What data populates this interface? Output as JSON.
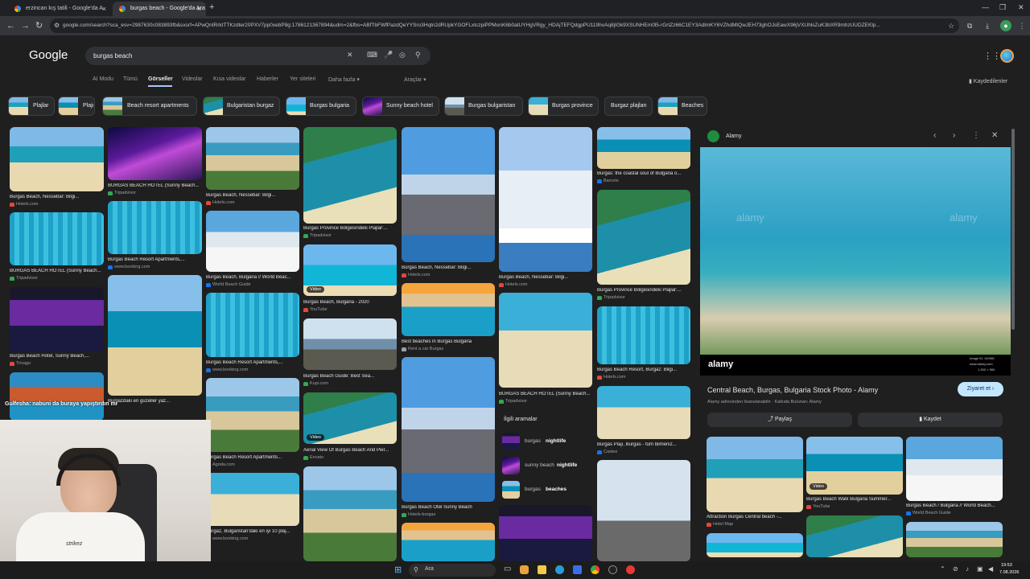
{
  "browser": {
    "tabs": [
      {
        "title": "erzincan kış tatili - Google'da A",
        "active": false
      },
      {
        "title": "burgas beach - Google'da Ara",
        "active": true
      }
    ],
    "url": "google.com/search?sca_esv=2987630c083893fb&sxsrf=APwQntRrktTTKzdter20PXV7pp0xebP8g:1786121367894&udm=2&fbs=ABfTbFWfPazdQeYYSro3Hqtn2dRUpkYGOFLxtczpiPPMonK6b0atUYHgVRgy_HDAjTEFQdgpPU119hvAq8jIGk9XSUNHEm0l5-rGrtZz66C1EY3AdlmKY6VZhdMtQwJEH73ghOJsEawX96jVXUhlsZuK3bXR9mhzUUDZEKlp...",
    "new_tab": "+",
    "nav": {
      "back": "←",
      "forward": "→",
      "reload": "↻"
    }
  },
  "google": {
    "logo": "Google",
    "query": "burgas beach",
    "tabs": [
      "AI Modu",
      "Tümü",
      "Görseller",
      "Videolar",
      "Kısa videolar",
      "Haberler",
      "Yer siteleri",
      "Daha fazla ▾"
    ],
    "tools": "Araçlar ▾",
    "saved": "Kaydedilenler",
    "chips": [
      "Plajlar",
      "Plajı",
      "Beach resort apartments",
      "Bulgaristan burgaz",
      "Burgas bulgaria",
      "Sunny beach hotel",
      "Burgas bulgaristan",
      "Burgas province",
      "Burgaz plajları",
      "Beaches"
    ]
  },
  "grid": {
    "items": [
      {
        "caption": "Burgas Beach, Nessebar: Bilgi...",
        "source": "Hotels.com"
      },
      {
        "caption": "BURGAS BEACH HOTEL (Sunny Beach...",
        "source": "Tripadvisor"
      },
      {
        "caption": "Burgas Beach, Nessebar: Bilgi...",
        "source": "Hotels.com"
      },
      {
        "caption": "Burgas Province Bölgesindeki Plajlar:...",
        "source": "Tripadvisor"
      },
      {
        "caption": "Burgas Beach, Nessebar: Bilgi...",
        "source": "Hotels.com"
      },
      {
        "caption": "Burgas Beach, Nessebar: Bilgi...",
        "source": "Hotels.com"
      },
      {
        "caption": "Burgas: the coastal soul of Bulgaria o...",
        "source": "Barcelo"
      },
      {
        "caption": "BURGAS BEACH HOTEL (Sunny Beach...",
        "source": "Tripadvisor"
      },
      {
        "caption": "Burgas Beach Resort Apartments,...",
        "source": "www.booking.com"
      },
      {
        "caption": "Burgas Beach, Bulgaria // World Beac...",
        "source": "World Beach Guide"
      },
      {
        "caption": "Burgas Beach, Bulgaria - 2020",
        "source": "YouTube"
      },
      {
        "caption": "Best beaches in Burgas Bulgaria",
        "source": "Rent a car Burgas"
      },
      {
        "caption": "Burgas Province Bölgesindeki Plajlar:...",
        "source": "Tripadvisor"
      },
      {
        "caption": "Burgas Beach Hotel, Sunny Beach,...",
        "source": "Trivago"
      },
      {
        "caption": "Burgas Beach Resort Apartments,...",
        "source": "www.booking.com"
      },
      {
        "caption": "Burgas Beach Guide: Best Sea...",
        "source": "Kupi.com"
      },
      {
        "caption": "Burgas Beach Resort, Burgaz: Bilgi...",
        "source": "Hotels.com"
      },
      {
        "caption": "BURGAS BEACH HOTEL (Sunny Beach...",
        "source": "Tripadvisor"
      },
      {
        "caption": "Burgazdaki en güzeller yaz...",
        "source": ""
      },
      {
        "caption": "Aerial View Of Burgas Beach And Pier...",
        "source": "Envato"
      },
      {
        "caption": "Burgas Plajı, Burgas - tüm bilmeniz...",
        "source": "Castee"
      },
      {
        "caption": "Burgas Beach Resort Apartments...",
        "source": "Agoda.com"
      },
      {
        "caption": "Burgas Beach Otel Sunny Beach",
        "source": "Hotels-burgas"
      },
      {
        "caption": "Burgaz, Bulgaristan'daki en iyi 10 plaj...",
        "source": "www.booking.com"
      }
    ],
    "video_badge": "Video",
    "related": {
      "title": "İlgili aramalar",
      "items": [
        {
          "prefix": "burgas",
          "suffix": "nightlife"
        },
        {
          "prefix": "sunny beach",
          "suffix": "nightlife"
        },
        {
          "prefix": "burgas",
          "suffix": "beaches"
        }
      ]
    }
  },
  "panel": {
    "site": "Alamy",
    "title": "Central Beach, Burgas, Bulgaria Stock Photo - Alamy",
    "visit": "Ziyaret et ›",
    "license": "Alamy adresinden lisanslanabilir · Katkıda Bulunan: Alamy",
    "share": "Paylaş",
    "save": "Kaydet",
    "watermark": "alamy",
    "image_id": "Image ID: K29N0",
    "image_site": "www.alamy.com",
    "image_size": "1.300 × 960",
    "related": [
      {
        "caption": "Attraction Burgas Central beach -...",
        "source": "Hotel Map"
      },
      {
        "caption": "Burgas Beach Walk Bulgaria Summer...",
        "source": "YouTube"
      },
      {
        "caption": "Burgas Beach / Bulgaria // World Beach...",
        "source": "World Beach Guide"
      }
    ]
  },
  "overlay": {
    "chat_text": "Gulfesha: nabuni da buraya yapıştırdın mı",
    "shirt_text": "strikez"
  },
  "taskbar": {
    "search": "Ara",
    "time": "19:53",
    "date": "7.08.2026"
  },
  "colors": {
    "accent": "#a8c7fa",
    "visit_btn": "#c2e7ff",
    "bg": "#1f1f1f"
  }
}
